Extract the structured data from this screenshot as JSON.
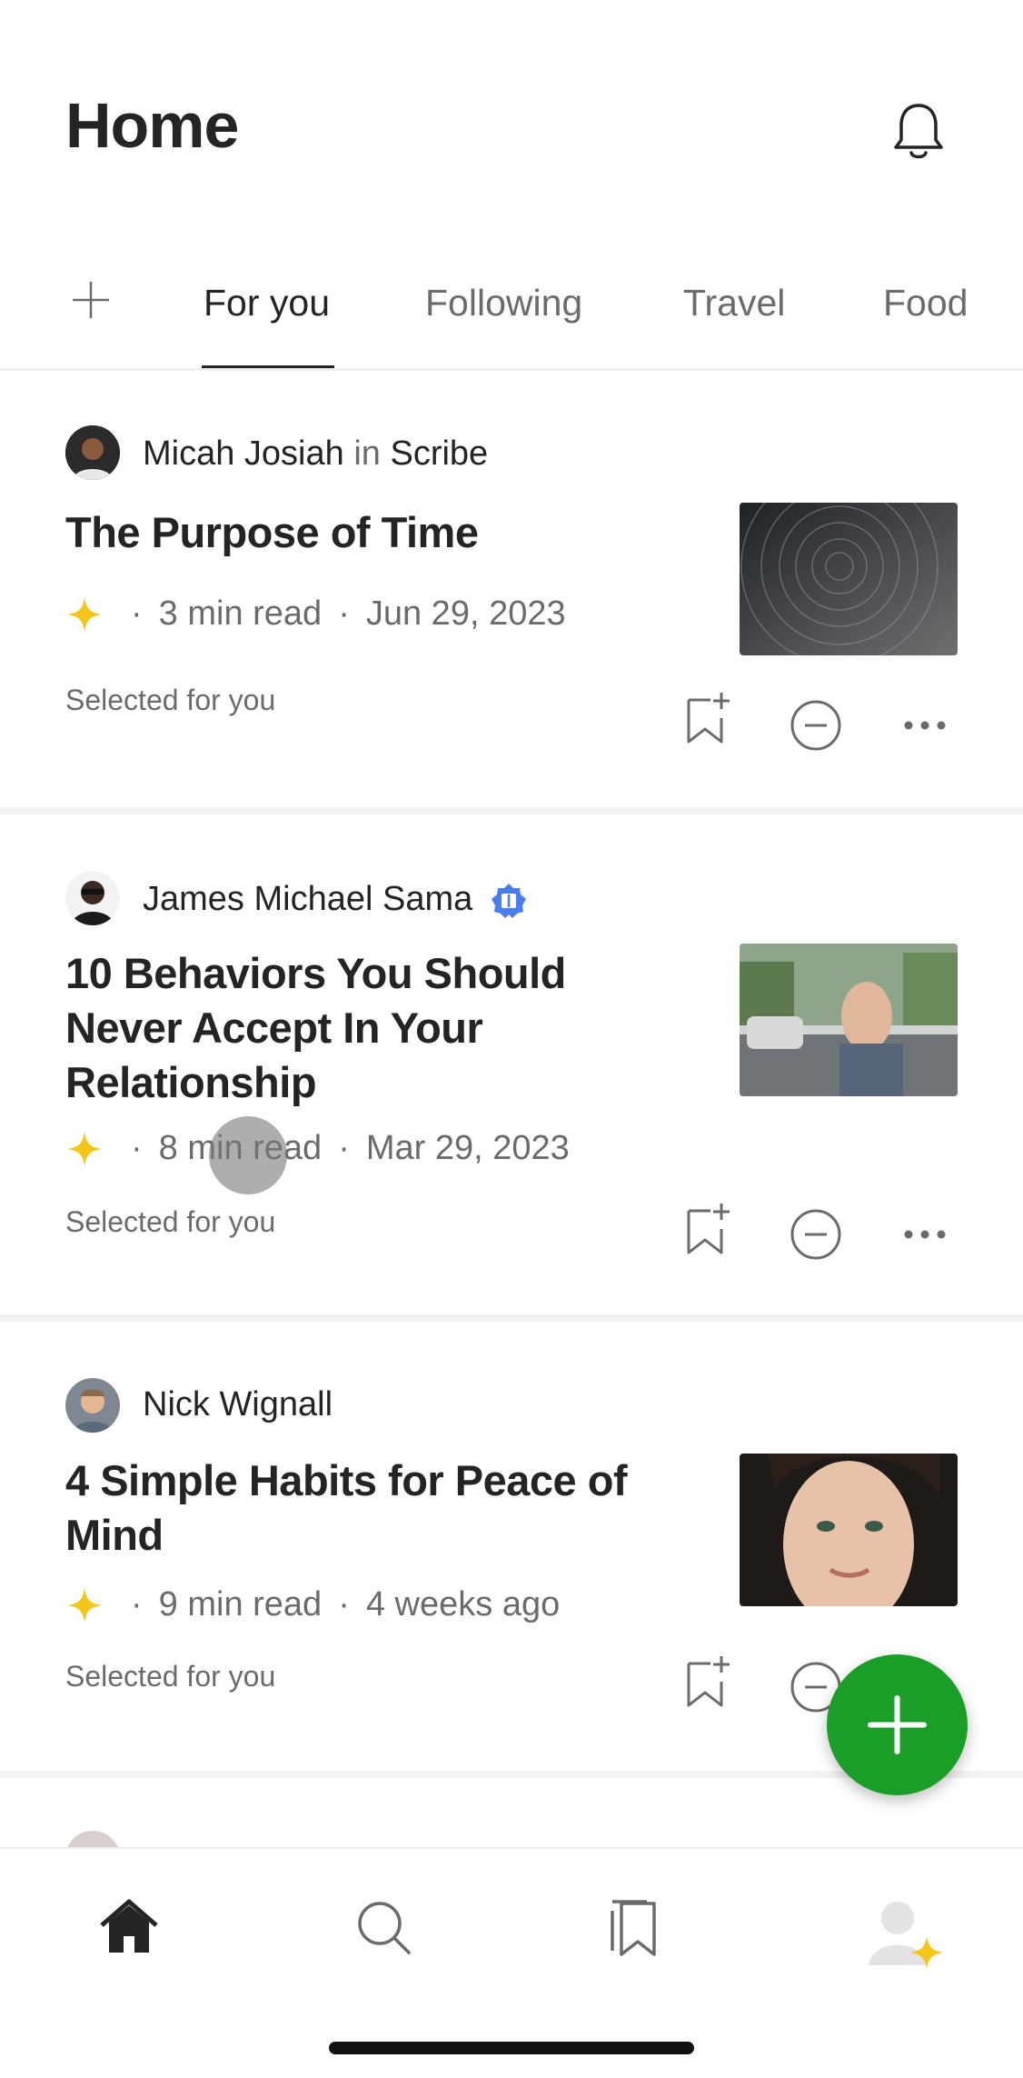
{
  "header": {
    "title": "Home"
  },
  "tabs": [
    {
      "label": "For you",
      "active": true
    },
    {
      "label": "Following"
    },
    {
      "label": "Travel"
    },
    {
      "label": "Food"
    }
  ],
  "articles": [
    {
      "author": "Micah Josiah",
      "in_word": "in",
      "publication": "Scribe",
      "title": "The Purpose of Time",
      "read_time": "3  min read",
      "date": "Jun 29, 2023",
      "reason": "Selected for you",
      "member_only": true
    },
    {
      "author": "James Michael Sama",
      "verified": true,
      "title": "10 Behaviors You Should Never Accept In Your Relationship",
      "read_time": "8  min read",
      "date": "Mar 29, 2023",
      "reason": "Selected for you",
      "member_only": true
    },
    {
      "author": "Nick Wignall",
      "title": "4 Simple Habits for Peace of Mind",
      "read_time": "9  min read",
      "date": "4 weeks ago",
      "reason": "Selected for you",
      "member_only": true
    }
  ],
  "colors": {
    "accent_green": "#1a9e27",
    "star": "#f5c518",
    "badge": "#4a7cf2"
  },
  "icons": [
    "bell-icon",
    "plus-icon",
    "bookmark-add-icon",
    "show-less-icon",
    "more-icon",
    "home-icon",
    "search-icon",
    "library-icon",
    "profile-icon"
  ]
}
